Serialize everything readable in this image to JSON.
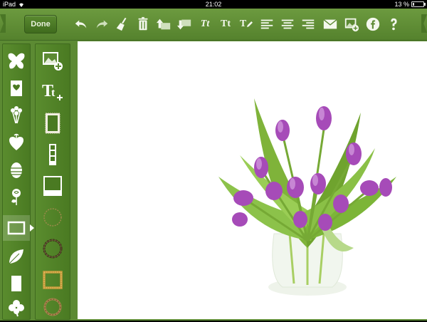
{
  "status_bar": {
    "device": "iPad",
    "time": "21:02",
    "battery": "13 %",
    "battery_fraction": 0.13
  },
  "toolbar": {
    "done_label": "Done",
    "icons": [
      "undo-icon",
      "redo-icon",
      "broom-icon",
      "trash-icon",
      "bring-forward-icon",
      "send-backward-icon",
      "text-italic-icon",
      "text-style-icon",
      "text-edit-icon",
      "align-left-icon",
      "align-center-icon",
      "align-right-icon",
      "mail-icon",
      "save-photo-icon",
      "facebook-icon",
      "help-icon"
    ],
    "text_tools": [
      "Tt",
      "Tt",
      "T"
    ]
  },
  "categories": [
    "butterfly-icon",
    "card-icon",
    "bouquet-icon",
    "heart-icon",
    "easter-egg-icon",
    "rose-icon",
    "frame-icon",
    "leaf-icon",
    "card-blank-icon",
    "clover-icon"
  ],
  "panel": [
    "add-photo-icon",
    "add-text-icon",
    "stamp-frame-icon",
    "film-strip-icon",
    "polaroid-frame-icon",
    "circle-frame-gold-icon",
    "wreath-frame-icon",
    "gold-square-frame-icon",
    "round-wreath-icon"
  ],
  "colors": {
    "green": "#5c8a33",
    "dark_green": "#3f6822",
    "canvas": "#ffffff",
    "tulip": "#a64bb8"
  }
}
